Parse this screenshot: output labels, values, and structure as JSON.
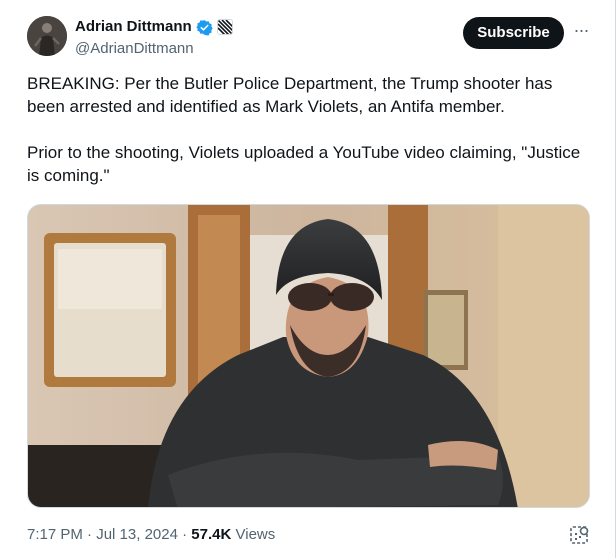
{
  "author": {
    "display_name": "Adrian Dittmann",
    "handle": "@AdrianDittmann",
    "verified": true,
    "affiliate_badge": "square-badge-icon"
  },
  "actions": {
    "subscribe_label": "Subscribe",
    "more_icon": "more-horizontal-icon"
  },
  "tweet": {
    "paragraphs": [
      "BREAKING: Per the Butler Police Department, the Trump shooter has been arrested and identified as Mark Violets, an Antifa member.",
      "Prior to the shooting, Violets uploaded a YouTube video claiming, \"Justice is coming.\""
    ]
  },
  "media": {
    "type": "photo",
    "description_icon": "embedded-video-still"
  },
  "meta": {
    "time": "7:17 PM",
    "separator": " · ",
    "date": "Jul 13, 2024",
    "views_count": "57.4K",
    "views_label": "Views"
  },
  "colors": {
    "text_primary": "#0f1419",
    "text_secondary": "#536471",
    "verified_blue": "#1d9bf0",
    "button_dark": "#0f1419"
  }
}
